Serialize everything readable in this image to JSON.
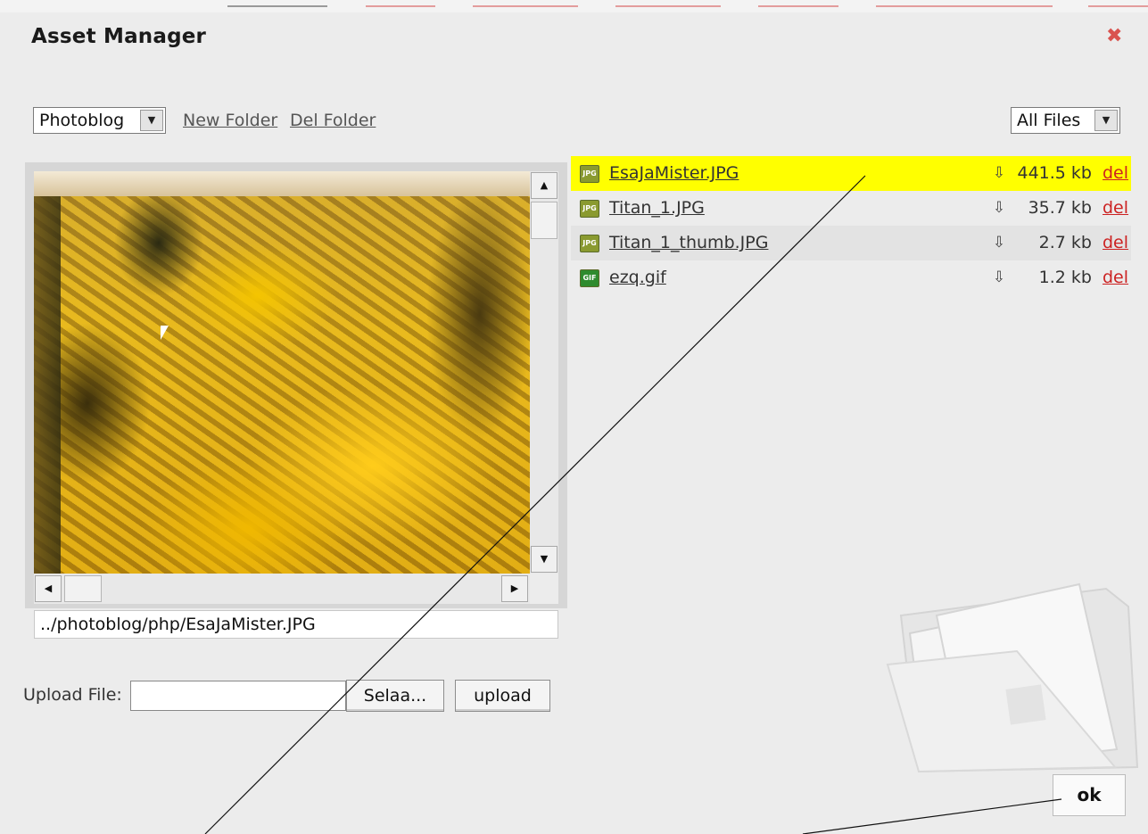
{
  "dialog": {
    "title": "Asset Manager"
  },
  "toolbar": {
    "folder_select": "Photoblog",
    "new_folder": "New Folder",
    "del_folder": "Del Folder",
    "filter_select": "All Files"
  },
  "preview": {
    "path": "../photoblog/php/EsaJaMister.JPG"
  },
  "files": [
    {
      "name": "EsaJaMister.JPG",
      "type": "JPG",
      "size": "441.5 kb",
      "del": "del"
    },
    {
      "name": "Titan_1.JPG",
      "type": "JPG",
      "size": "35.7 kb",
      "del": "del"
    },
    {
      "name": "Titan_1_thumb.JPG",
      "type": "JPG",
      "size": "2.7 kb",
      "del": "del"
    },
    {
      "name": "ezq.gif",
      "type": "GIF",
      "size": "1.2 kb",
      "del": "del"
    }
  ],
  "upload": {
    "label": "Upload File:",
    "browse": "Selaa...",
    "upload": "upload"
  },
  "footer": {
    "ok": "ok"
  },
  "colors": {
    "selected_row": "#ffff00",
    "delete_link": "#cc2222",
    "close": "#d9534f"
  }
}
